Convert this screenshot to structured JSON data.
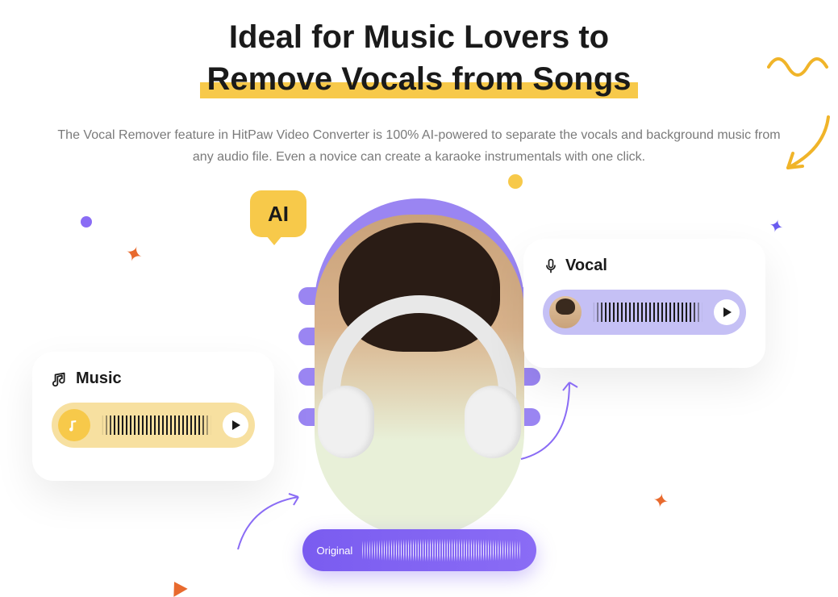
{
  "heading": {
    "line1": "Ideal for Music Lovers to",
    "line2": "Remove Vocals from Songs"
  },
  "description": "The Vocal Remover feature in HitPaw Video Converter is 100% AI-powered to separate the vocals and background music from any audio file. Even a novice can create a karaoke instrumentals with one click.",
  "ai_badge": "AI",
  "original_label": "Original",
  "cards": {
    "music": {
      "title": "Music"
    },
    "vocal": {
      "title": "Vocal"
    }
  }
}
